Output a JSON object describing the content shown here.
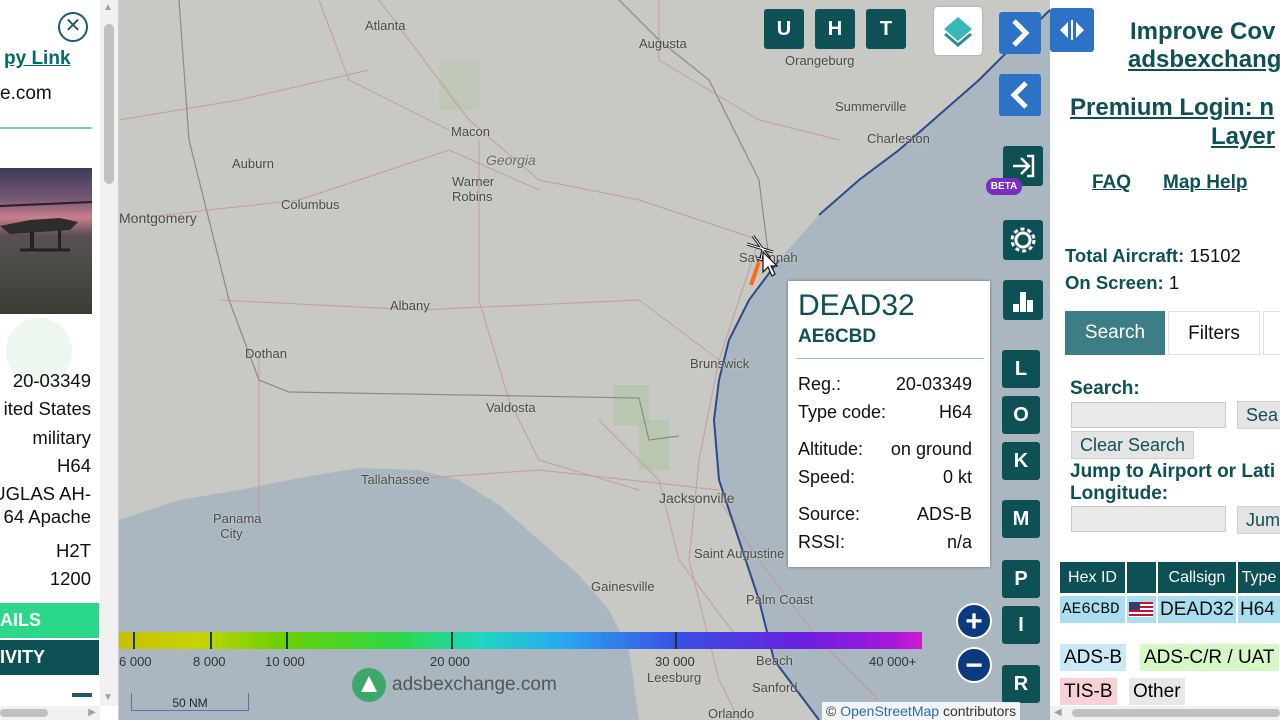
{
  "left_panel": {
    "close_icon": "close-icon",
    "link_text": "py Link",
    "domain_text": "e.com",
    "reg": "20-03349",
    "country": "ited States",
    "category": "military",
    "type_code": "H64",
    "type_line1": "UGLAS AH-",
    "type_line2": "64 Apache",
    "wtc": "H2T",
    "squawk": "1200",
    "details_label": "AILS",
    "activity_label": "IVITY"
  },
  "map": {
    "cities": [
      {
        "name": "Atlanta",
        "cls": "city"
      },
      {
        "name": "Augusta",
        "cls": "city"
      },
      {
        "name": "Orangeburg",
        "cls": "city"
      },
      {
        "name": "Summerville",
        "cls": "city"
      },
      {
        "name": "Charleston",
        "cls": "city"
      },
      {
        "name": "Macon",
        "cls": "city"
      },
      {
        "name": "Georgia",
        "cls": "city state"
      },
      {
        "name": "Auburn",
        "cls": "city"
      },
      {
        "name": "Warner\nRobins",
        "cls": "city"
      },
      {
        "name": "Columbus",
        "cls": "city"
      },
      {
        "name": "Montgomery",
        "cls": "city"
      },
      {
        "name": "Savannah",
        "cls": "city"
      },
      {
        "name": "Albany",
        "cls": "city"
      },
      {
        "name": "Dothan",
        "cls": "city"
      },
      {
        "name": "Brunswick",
        "cls": "city"
      },
      {
        "name": "Valdosta",
        "cls": "city"
      },
      {
        "name": "Tallahassee",
        "cls": "city"
      },
      {
        "name": "Jacksonville",
        "cls": "city"
      },
      {
        "name": "Panama\nCity",
        "cls": "city"
      },
      {
        "name": "Saint Augustine",
        "cls": "city"
      },
      {
        "name": "Gainesville",
        "cls": "city"
      },
      {
        "name": "Palm Coast",
        "cls": "city"
      },
      {
        "name": "Beach",
        "cls": "city"
      },
      {
        "name": "Leesburg",
        "cls": "city"
      },
      {
        "name": "Sanford",
        "cls": "city"
      },
      {
        "name": "Orlando",
        "cls": "city"
      }
    ],
    "top_buttons": {
      "u": "U",
      "h": "H",
      "t": "T"
    },
    "side_buttons": {
      "l": "L",
      "o": "O",
      "k": "K",
      "m": "M",
      "p": "P",
      "i": "I",
      "r": "R"
    },
    "beta_badge": "BETA",
    "popup": {
      "callsign": "DEAD32",
      "hex": "AE6CBD",
      "reg_label": "Reg.:",
      "reg_value": "20-03349",
      "type_label": "Type code:",
      "type_value": "H64",
      "altitude_label": "Altitude:",
      "altitude_value": "on ground",
      "speed_label": "Speed:",
      "speed_value": "0 kt",
      "source_label": "Source:",
      "source_value": "ADS-B",
      "rssi_label": "RSSI:",
      "rssi_value": "n/a"
    },
    "altitude_scale": [
      "6 000",
      "8 000",
      "10 000",
      "20 000",
      "30 000",
      "40 000+"
    ],
    "nm_scale": "50 NM",
    "watermark": "adsbexchange.com",
    "attribution_prefix": "©",
    "attribution_link": "OpenStreetMap",
    "attribution_suffix": "contributors",
    "zoom_in": "+",
    "zoom_out": "−"
  },
  "right_panel": {
    "improve_line1": "Improve Cov",
    "improve_line2": "adsbexchang",
    "premium_line1": "Premium Login: n",
    "premium_line2": "Layer",
    "faq": "FAQ",
    "map_help": "Map Help",
    "total_label": "Total Aircraft:",
    "total_value": "15102",
    "onscreen_label": "On Screen:",
    "onscreen_value": "1",
    "tab_search": "Search",
    "tab_filters": "Filters",
    "search_label": "Search:",
    "search_button": "Sea",
    "clear_search": "Clear Search",
    "jump_label1": "Jump to Airport or Lati",
    "jump_label2": "Longitude:",
    "jump_button": "Jum",
    "table_headers": [
      "Hex ID",
      "",
      "Callsign",
      "Type"
    ],
    "row": {
      "hex": "AE6CBD",
      "callsign": "DEAD32",
      "type": "H64"
    },
    "legend": [
      {
        "label": "ADS-B",
        "color": "#c9e9f6"
      },
      {
        "label": "ADS-C/R / UAT",
        "color": "#d6f7c6"
      },
      {
        "label": "TIS-B",
        "color": "#f9d0d8"
      },
      {
        "label": "Other",
        "color": "#e8e8e8"
      }
    ]
  },
  "colors": {
    "teal_dark": "#0d5157",
    "teal_text": "#006b6b",
    "green_btn": "#2bd88a",
    "blue_btn": "#2c72c7",
    "row_highlight": "#a9ddf0",
    "aircraft_trail": "#ff6a1a"
  }
}
